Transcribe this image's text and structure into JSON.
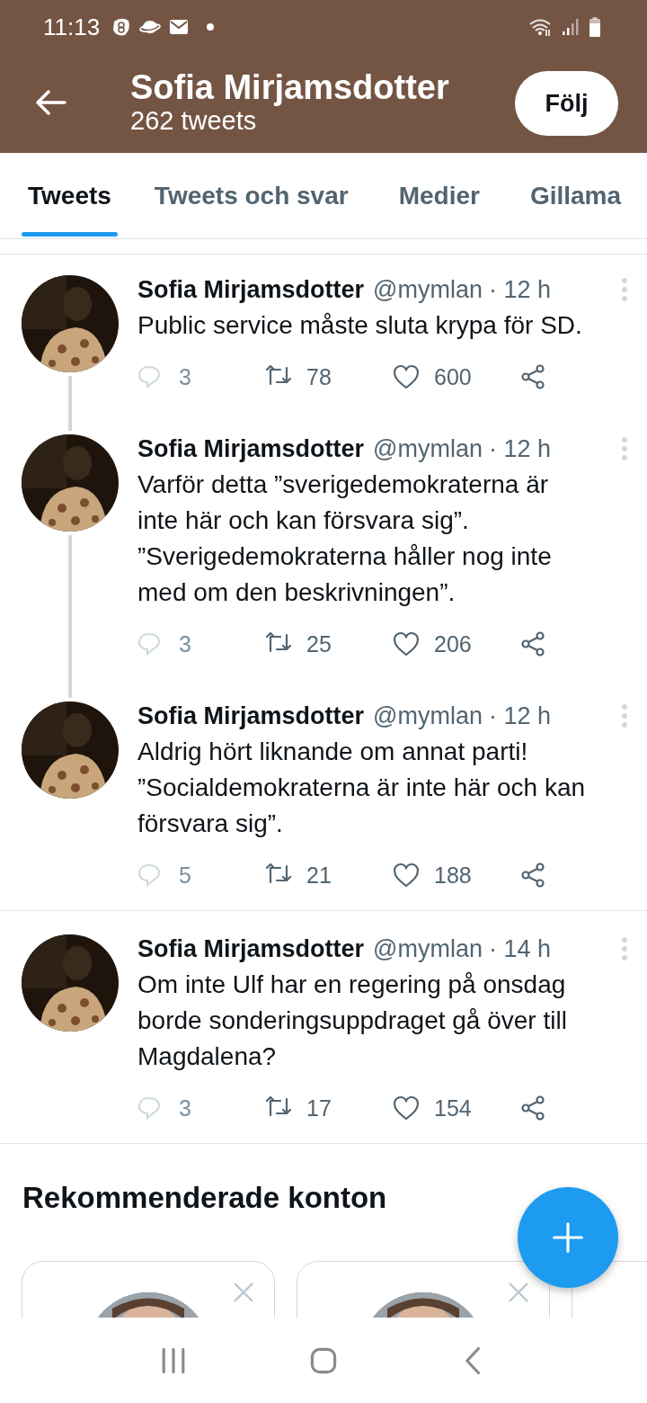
{
  "status_bar": {
    "time": "11:13"
  },
  "header": {
    "name": "Sofia Mirjamsdotter",
    "tweet_count": "262 tweets",
    "follow_button": "Följ"
  },
  "tabs": [
    {
      "label": "Tweets",
      "selected": true
    },
    {
      "label": "Tweets och svar",
      "selected": false
    },
    {
      "label": "Medier",
      "selected": false
    },
    {
      "label": "Gillama",
      "selected": false
    }
  ],
  "tweets": [
    {
      "name": "Sofia Mirjamsdotter",
      "handle": "@mymlan",
      "time": "· 12 h",
      "lines": [
        "Public service måste sluta krypa för SD."
      ],
      "replies": "3",
      "retweets": "78",
      "likes": "600",
      "thread_continues": true
    },
    {
      "name": "Sofia Mirjamsdotter",
      "handle": "@mymlan",
      "time": "· 12 h",
      "lines": [
        "Varför detta ”sverigedemokraterna är",
        "inte här och kan försvara sig”.",
        "”Sverigedemokraterna håller nog inte",
        "med om den beskrivningen”."
      ],
      "replies": "3",
      "retweets": "25",
      "likes": "206",
      "thread_continues": true
    },
    {
      "name": "Sofia Mirjamsdotter",
      "handle": "@mymlan",
      "time": "· 12 h",
      "lines": [
        "Aldrig hört liknande om annat parti!",
        "”Socialdemokraterna är inte här och kan",
        "försvara sig”."
      ],
      "replies": "5",
      "retweets": "21",
      "likes": "188",
      "thread_continues": false
    },
    {
      "name": "Sofia Mirjamsdotter",
      "handle": "@mymlan",
      "time": "· 14 h",
      "lines": [
        "Om inte Ulf har en regering på onsdag",
        "borde sonderingsuppdraget gå över till",
        "Magdalena?"
      ],
      "replies": "3",
      "retweets": "17",
      "likes": "154",
      "thread_continues": false
    }
  ],
  "recommended": {
    "title": "Rekommenderade konton",
    "cards": [
      {
        "kind": "picture"
      },
      {
        "kind": "picture"
      },
      {
        "kind": "empty"
      }
    ]
  }
}
